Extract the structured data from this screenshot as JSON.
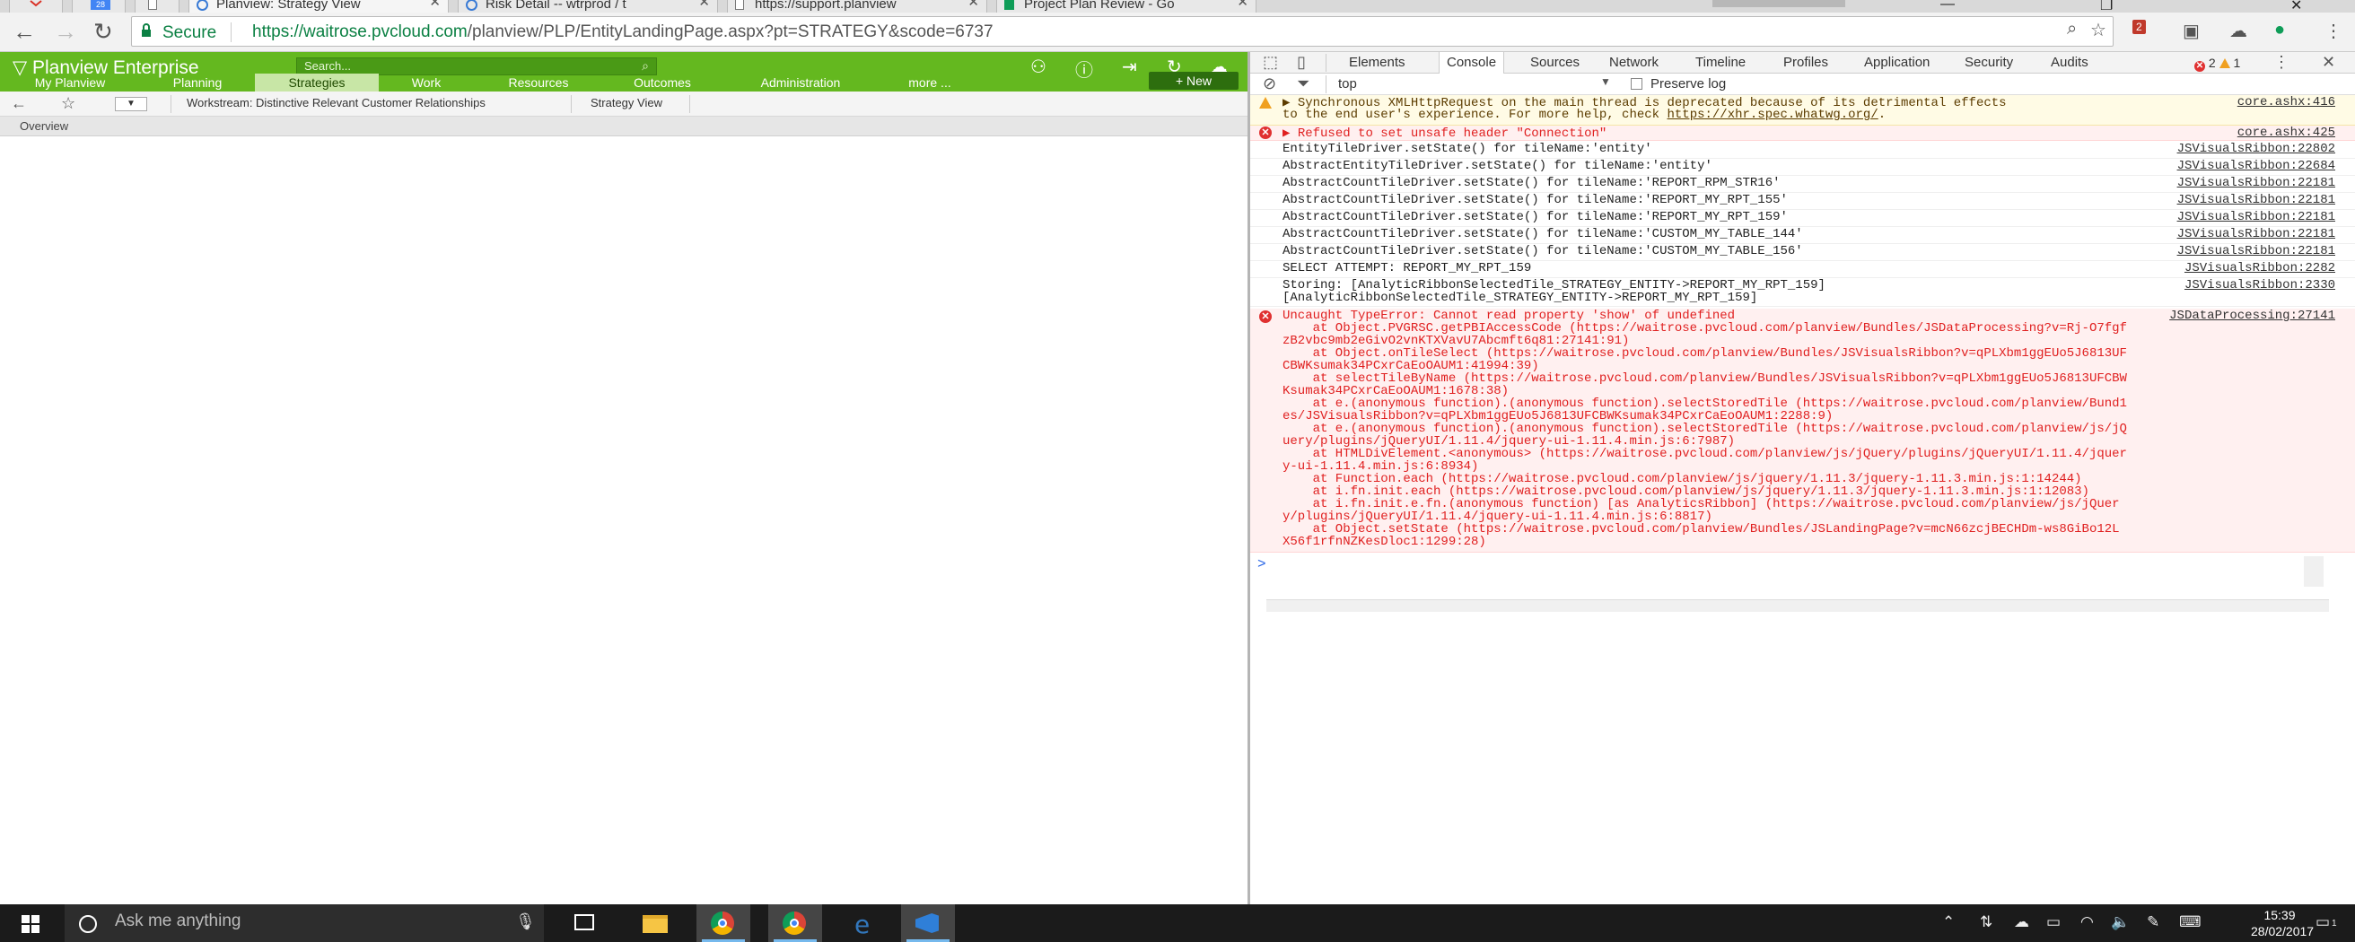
{
  "browser": {
    "tabs": [
      {
        "label": "",
        "icon": "gmail-icon"
      },
      {
        "label": "",
        "icon": "calendar-icon",
        "badge": "28"
      },
      {
        "label": "",
        "icon": "document-icon"
      },
      {
        "label": "Planview: Strategy View",
        "icon": "planview-icon",
        "active": true
      },
      {
        "label": "Risk Detail -- wtrprod / t",
        "icon": "planview-icon"
      },
      {
        "label": "https://support.planview",
        "icon": "document-icon"
      },
      {
        "label": "Project Plan Review - Go",
        "icon": "sheets-icon"
      }
    ],
    "secure_label": "Secure",
    "url_main": "https://waitrose.pvcloud.com",
    "url_path": "/planview/PLP/EntityLandingPage.aspx?pt=STRATEGY&scode=6737",
    "ext_badge": "2"
  },
  "planview": {
    "brand": "Planview Enterprise",
    "search_placeholder": "Search...",
    "nav": [
      {
        "label": "My Planview",
        "selected": false
      },
      {
        "label": "Planning",
        "selected": false
      },
      {
        "label": "Strategies",
        "selected": true
      },
      {
        "label": "Work",
        "selected": false
      },
      {
        "label": "Resources",
        "selected": false
      },
      {
        "label": "Outcomes",
        "selected": false
      },
      {
        "label": "Administration",
        "selected": false
      },
      {
        "label": "more ...",
        "selected": false
      }
    ],
    "new_button": "+ New",
    "workstream": "Workstream: Distinctive Relevant Customer Relationships",
    "strategy_view": "Strategy View",
    "overview_tab": "Overview"
  },
  "devtools": {
    "tabs": [
      "Elements",
      "Console",
      "Sources",
      "Network",
      "Timeline",
      "Profiles",
      "Application",
      "Security",
      "Audits"
    ],
    "active_tab": "Console",
    "error_count": "2",
    "warning_count": "1",
    "context": "top",
    "preserve_log_label": "Preserve log",
    "messages": [
      {
        "level": "warn",
        "text": "▶ Synchronous XMLHttpRequest on the main thread is deprecated because of its detrimental effects",
        "text2": "to the end user's experience. For more help, check ",
        "link": "https://xhr.spec.whatwg.org/",
        "text3": ".",
        "source": "core.ashx:416"
      },
      {
        "level": "err",
        "text": "▶ Refused to set unsafe header \"Connection\"",
        "source": "core.ashx:425"
      },
      {
        "level": "log",
        "text": "EntityTileDriver.setState() for tileName:'entity'",
        "source": "JSVisualsRibbon:22802"
      },
      {
        "level": "log",
        "text": "AbstractEntityTileDriver.setState() for tileName:'entity'",
        "source": "JSVisualsRibbon:22684"
      },
      {
        "level": "log",
        "text": "AbstractCountTileDriver.setState() for tileName:'REPORT_RPM_STR16'",
        "source": "JSVisualsRibbon:22181"
      },
      {
        "level": "log",
        "text": "AbstractCountTileDriver.setState() for tileName:'REPORT_MY_RPT_155'",
        "source": "JSVisualsRibbon:22181"
      },
      {
        "level": "log",
        "text": "AbstractCountTileDriver.setState() for tileName:'REPORT_MY_RPT_159'",
        "source": "JSVisualsRibbon:22181"
      },
      {
        "level": "log",
        "text": "AbstractCountTileDriver.setState() for tileName:'CUSTOM_MY_TABLE_144'",
        "source": "JSVisualsRibbon:22181"
      },
      {
        "level": "log",
        "text": "AbstractCountTileDriver.setState() for tileName:'CUSTOM_MY_TABLE_156'",
        "source": "JSVisualsRibbon:22181"
      },
      {
        "level": "log",
        "text": "SELECT ATTEMPT: REPORT_MY_RPT_159",
        "source": "JSVisualsRibbon:2282"
      },
      {
        "level": "log",
        "text": "Storing: [AnalyticRibbonSelectedTile_STRATEGY_ENTITY->REPORT_MY_RPT_159]",
        "text2": "[AnalyticRibbonSelectedTile_STRATEGY_ENTITY->REPORT_MY_RPT_159]",
        "source": "JSVisualsRibbon:2330"
      }
    ],
    "error": {
      "title": "Uncaught TypeError: Cannot read property 'show' of undefined",
      "source": "JSDataProcessing:27141",
      "stack": [
        "    at Object.PVGRSC.getPBIAccessCode (https://waitrose.pvcloud.com/planview/Bundles/JSDataProcessing?v=Rj-O7fgf",
        "zB2vbc9mb2eGivO2vnKTXVavU7Abcmft6q81:27141:91)",
        "    at Object.onTileSelect (https://waitrose.pvcloud.com/planview/Bundles/JSVisualsRibbon?v=qPLXbm1ggEUo5J6813UF",
        "CBWKsumak34PCxrCaEoOAUM1:41994:39)",
        "    at selectTileByName (https://waitrose.pvcloud.com/planview/Bundles/JSVisualsRibbon?v=qPLXbm1ggEUo5J6813UFCBW",
        "Ksumak34PCxrCaEoOAUM1:1678:38)",
        "    at e.(anonymous function).(anonymous function).selectStoredTile (https://waitrose.pvcloud.com/planview/Bund1",
        "es/JSVisualsRibbon?v=qPLXbm1ggEUo5J6813UFCBWKsumak34PCxrCaEoOAUM1:2288:9)",
        "    at e.(anonymous function).(anonymous function).selectStoredTile (https://waitrose.pvcloud.com/planview/js/jQ",
        "uery/plugins/jQueryUI/1.11.4/jquery-ui-1.11.4.min.js:6:7987)",
        "    at HTMLDivElement.<anonymous> (https://waitrose.pvcloud.com/planview/js/jQuery/plugins/jQueryUI/1.11.4/jquer",
        "y-ui-1.11.4.min.js:6:8934)",
        "    at Function.each (https://waitrose.pvcloud.com/planview/js/jquery/1.11.3/jquery-1.11.3.min.js:1:14244)",
        "    at i.fn.init.each (https://waitrose.pvcloud.com/planview/js/jquery/1.11.3/jquery-1.11.3.min.js:1:12083)",
        "    at i.fn.init.e.fn.(anonymous function) [as AnalyticsRibbon] (https://waitrose.pvcloud.com/planview/js/jQuer",
        "y/plugins/jQueryUI/1.11.4/jquery-ui-1.11.4.min.js:6:8817)",
        "    at Object.setState (https://waitrose.pvcloud.com/planview/Bundles/JSLandingPage?v=mcN66zcjBECHDm-ws8GiBo12L",
        "X56f1rfnNZKesDloc1:1299:28)"
      ]
    },
    "prompt": ">"
  },
  "taskbar": {
    "search_text": "Ask me anything",
    "time": "15:39",
    "date": "28/02/2017",
    "notifications": "1",
    "apps": [
      "task-view-icon",
      "file-explorer-icon",
      "chrome-icon",
      "chrome-canary-icon",
      "edge-icon",
      "visual-studio-icon"
    ]
  },
  "colors": {
    "planview_green": "#64b81f",
    "error_red": "#e02020",
    "taskbar": "#1b1b1b"
  }
}
